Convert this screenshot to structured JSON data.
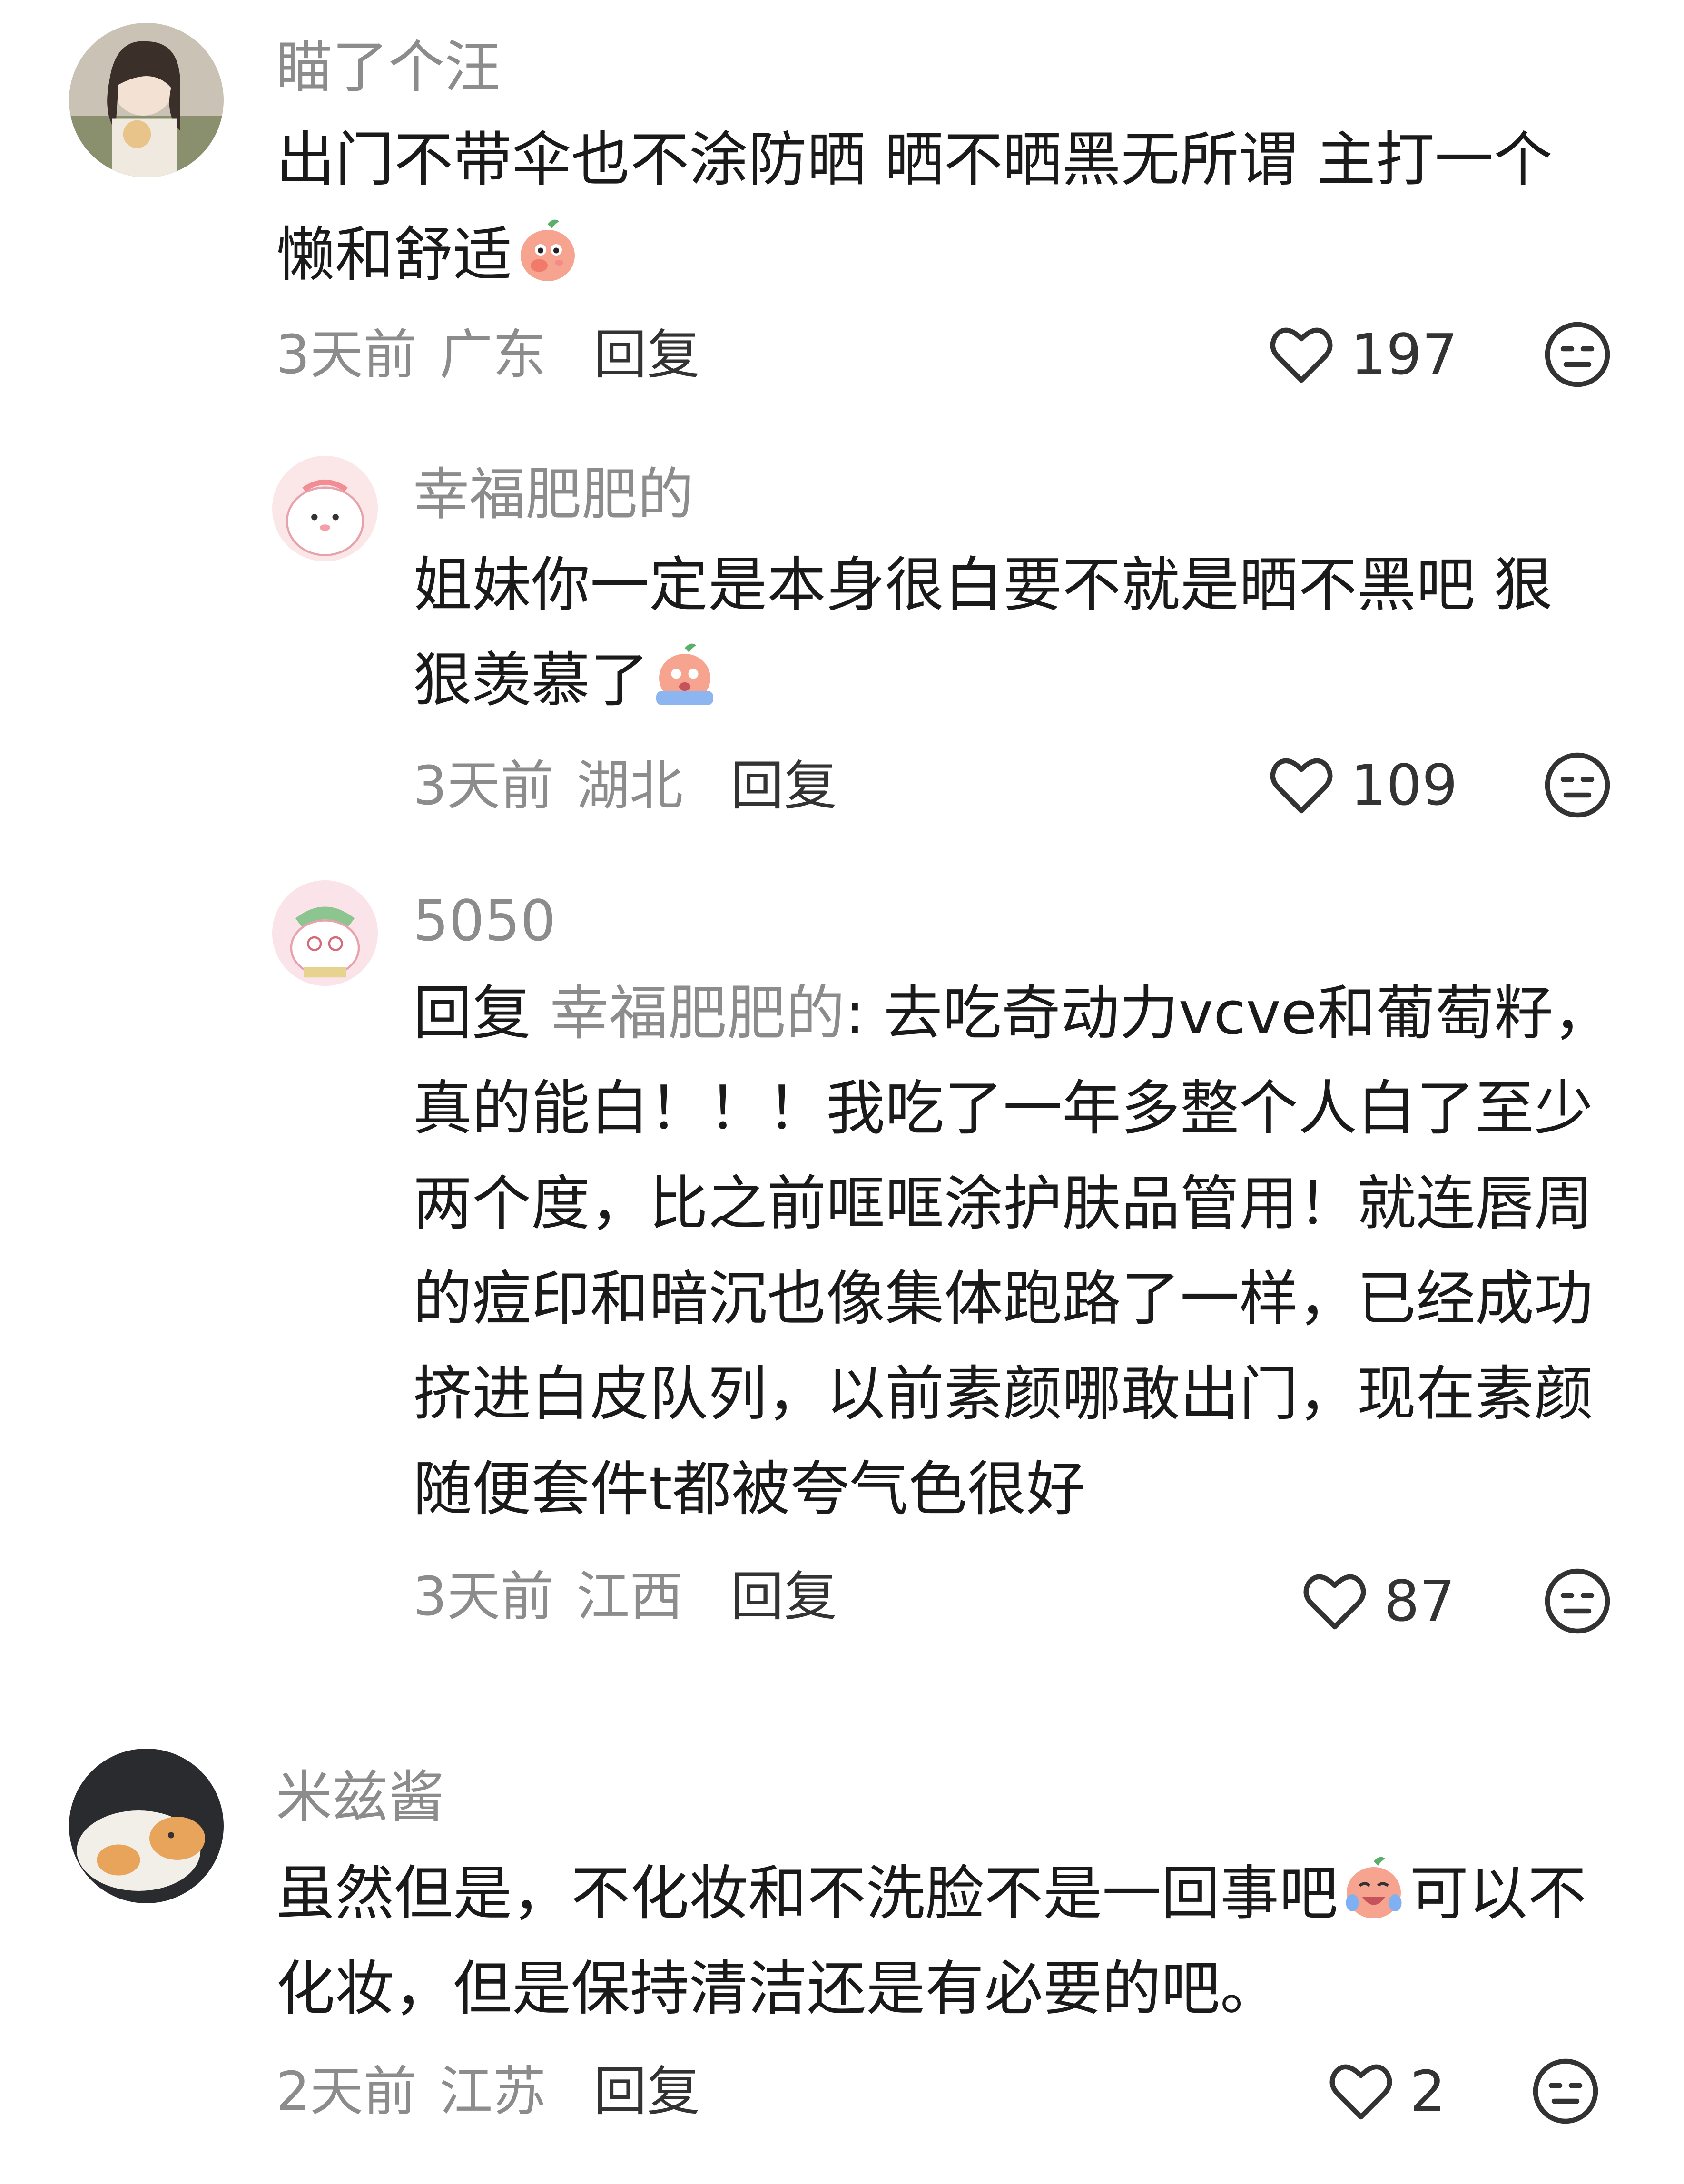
{
  "comments": [
    {
      "username": "瞄了个汪",
      "lines": [
        "出门不带伞也不涂防晒 晒不晒黑无所谓 主打一个",
        "懒和舒适"
      ],
      "time": "3天前",
      "location": "广东",
      "reply_label": "回复",
      "likes": "197"
    },
    {
      "username": "幸福肥肥的",
      "lines": [
        "姐妹你一定是本身很白要不就是晒不黑吧 狠",
        "狠羡慕了"
      ],
      "time": "3天前",
      "location": "湖北",
      "reply_label": "回复",
      "likes": "109"
    },
    {
      "username": "5050",
      "reply_prefix": "回复",
      "reply_target": "幸福肥肥的",
      "lines": [
        "去吃奇动力vcve和葡萄籽，",
        "真的能白！！！我吃了一年多整个人白了至少",
        "两个度，比之前哐哐涂护肤品管用！就连唇周",
        "的痘印和暗沉也像集体跑路了一样，已经成功",
        "挤进白皮队列，以前素颜哪敢出门，现在素颜",
        "随便套件t都被夸气色很好"
      ],
      "time": "3天前",
      "location": "江西",
      "reply_label": "回复",
      "likes": "87"
    },
    {
      "username": "米兹酱",
      "lines": [
        "虽然但是，不化妆和不洗脸不是一回事吧",
        "可以不",
        "化妆，但是保持清洁还是有必要的吧。"
      ],
      "time": "2天前",
      "location": "江苏",
      "reply_label": "回复",
      "likes": "2"
    }
  ],
  "icons": {
    "like": "heart-outline-icon",
    "dislike": "meh-face-icon"
  },
  "colors": {
    "username": "#8c8c8c",
    "text": "#1a1a1a",
    "meta": "#8c8c8c",
    "icon": "#333333"
  }
}
